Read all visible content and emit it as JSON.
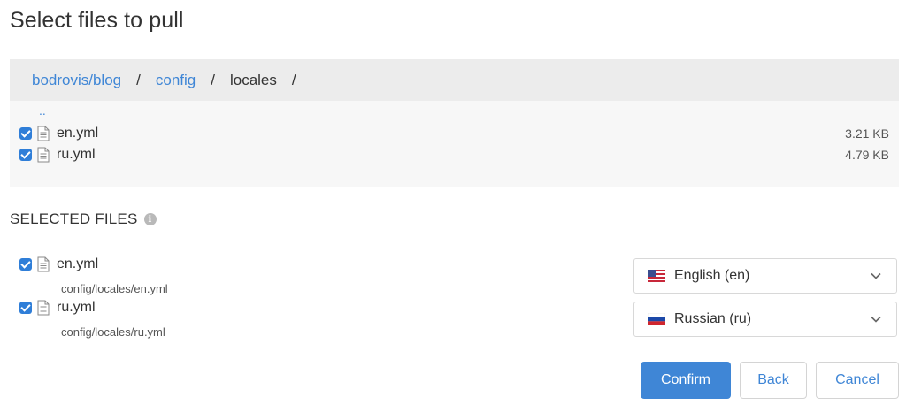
{
  "page": {
    "title": "Select files to pull"
  },
  "breadcrumb": {
    "items": [
      {
        "label": "bodrovis/blog",
        "link": true
      },
      {
        "label": "config",
        "link": true
      },
      {
        "label": "locales",
        "link": false
      }
    ],
    "separator": "/"
  },
  "browser": {
    "parent_link": "..",
    "files": [
      {
        "name": "en.yml",
        "size": "3.21 KB",
        "checked": true,
        "icon": "file-doc-icon"
      },
      {
        "name": "ru.yml",
        "size": "4.79 KB",
        "checked": true,
        "icon": "file-doc-icon"
      }
    ]
  },
  "selected": {
    "heading": "SELECTED FILES",
    "info_icon": "info-icon",
    "files": [
      {
        "name": "en.yml",
        "path": "config/locales/en.yml",
        "language": "English (en)",
        "flag": "us-flag-icon"
      },
      {
        "name": "ru.yml",
        "path": "config/locales/ru.yml",
        "language": "Russian (ru)",
        "flag": "ru-flag-icon"
      }
    ]
  },
  "buttons": {
    "confirm": "Confirm",
    "back": "Back",
    "cancel": "Cancel"
  },
  "colors": {
    "accent": "#3f86d6",
    "checkbox": "#2f7ed8",
    "breadcrumb_bg": "#ececec",
    "panel_bg": "#f7f7f7"
  }
}
